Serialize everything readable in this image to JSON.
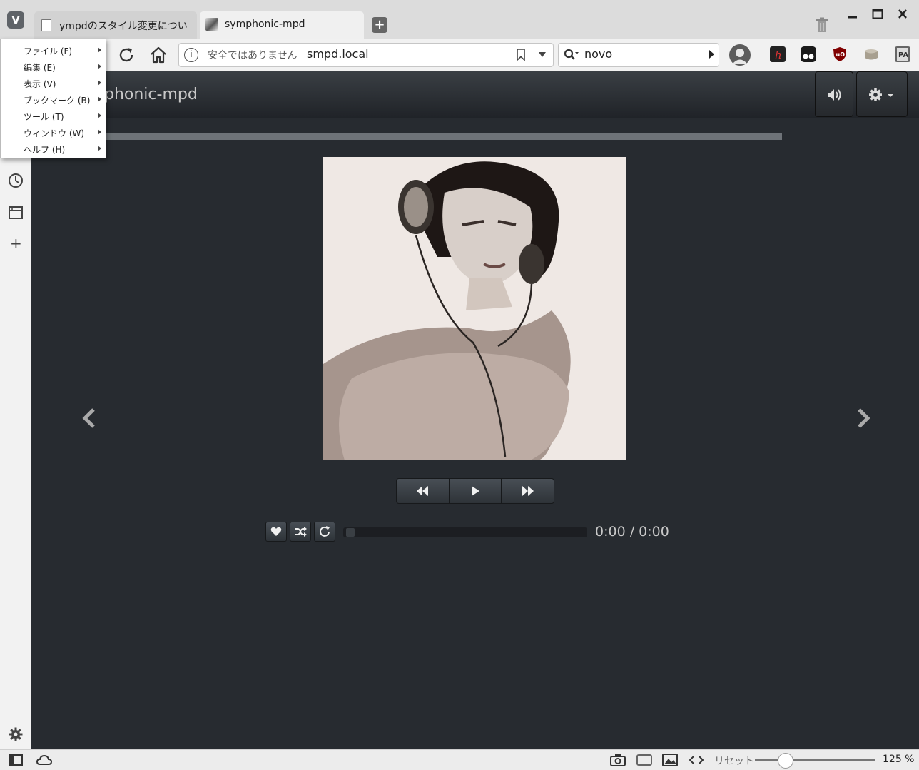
{
  "browser": {
    "tabs": [
      {
        "title": "ympdのスタイル変更につい"
      },
      {
        "title": "symphonic-mpd"
      }
    ],
    "address": {
      "security_text": "安全ではありません",
      "url": "smpd.local"
    },
    "search": {
      "value": "novo"
    },
    "menu": {
      "items": [
        {
          "label": "ファイル (F)"
        },
        {
          "label": "編集 (E)"
        },
        {
          "label": "表示 (V)"
        },
        {
          "label": "ブックマーク (B)"
        },
        {
          "label": "ツール (T)"
        },
        {
          "label": "ウィンドウ (W)"
        },
        {
          "label": "ヘルプ (H)"
        }
      ]
    },
    "status": {
      "reset_label": "リセット",
      "zoom": "125 %",
      "zoom_level": 0.25
    },
    "window_controls": [
      "minimize-icon",
      "maximize-icon",
      "close-icon"
    ],
    "extension_icons": [
      "hatena-icon",
      "tampermonkey-icon",
      "ublock-icon",
      "database-icon",
      "page-action-icon"
    ],
    "sidebar_icons": [
      "history-icon",
      "window-panel-icon",
      "add-panel-icon",
      "settings-icon"
    ]
  },
  "page": {
    "brand": "phonic-mpd",
    "time": "0:00 / 0:00",
    "progress": 0,
    "colors": {
      "background": "#272b30",
      "navbar": "#3a3f44",
      "volume_bar": "#6e7378"
    }
  }
}
